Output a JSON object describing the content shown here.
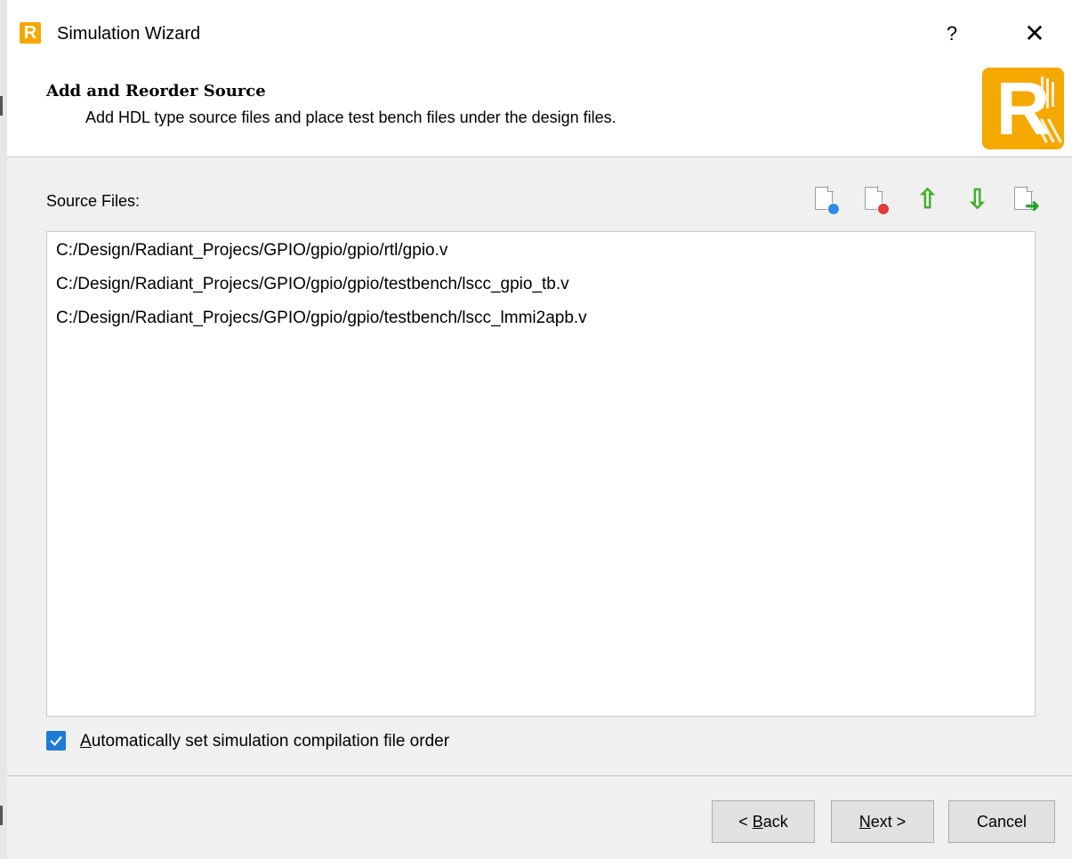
{
  "window": {
    "title": "Simulation Wizard",
    "app_icon_letter": "R",
    "help_label": "?",
    "close_label": "✕"
  },
  "header": {
    "title": "Add and Reorder Source",
    "subtitle": "Add HDL type source files and place test bench files under the design files.",
    "logo_letter": "R",
    "brand_color": "#f5a800"
  },
  "source": {
    "label": "Source Files:",
    "toolbar": [
      {
        "icon": "add-file-icon"
      },
      {
        "icon": "remove-file-icon"
      },
      {
        "icon": "move-up-icon"
      },
      {
        "icon": "move-down-icon"
      },
      {
        "icon": "export-file-icon"
      }
    ],
    "files": [
      "C:/Design/Radiant_Projecs/GPIO/gpio/gpio/rtl/gpio.v",
      "C:/Design/Radiant_Projecs/GPIO/gpio/gpio/testbench/lscc_gpio_tb.v",
      "C:/Design/Radiant_Projecs/GPIO/gpio/gpio/testbench/lscc_lmmi2apb.v"
    ]
  },
  "options": {
    "auto_order": {
      "label_mnemonic": "A",
      "label_rest": "utomatically set simulation compilation file order",
      "checked": true
    }
  },
  "footer": {
    "back": {
      "prefix": "< ",
      "mnemonic": "B",
      "rest": "ack"
    },
    "next": {
      "prefix": "",
      "mnemonic": "N",
      "rest": "ext >"
    },
    "cancel": "Cancel"
  }
}
